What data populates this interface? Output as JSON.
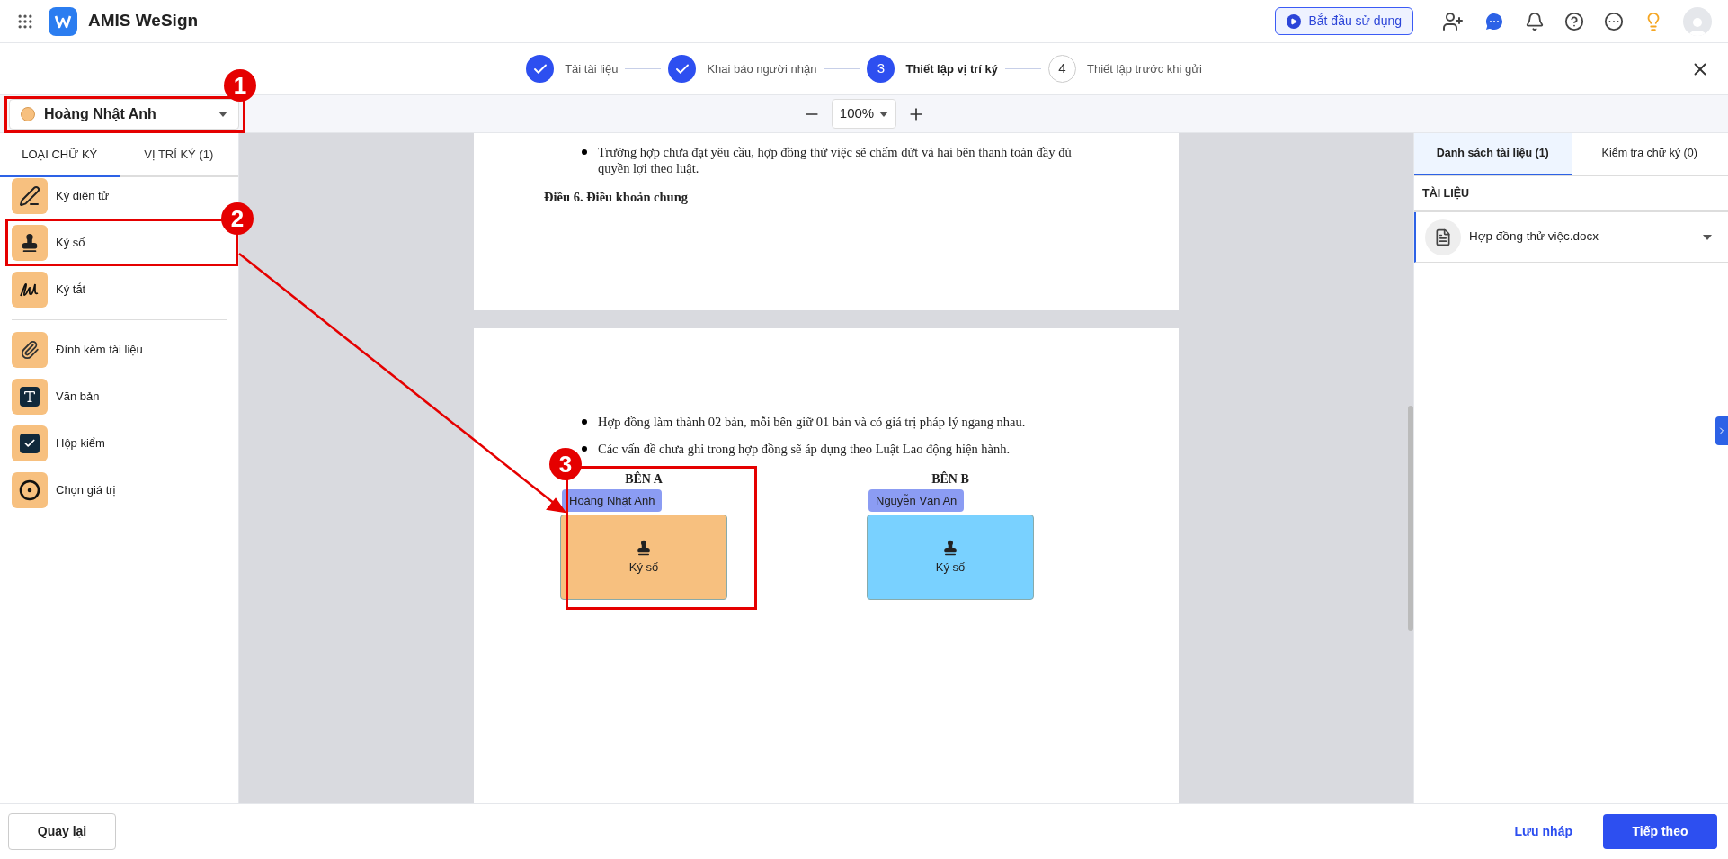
{
  "app": {
    "name": "AMIS WeSign"
  },
  "header": {
    "start_button": "Bắt đầu sử dụng"
  },
  "steps": [
    {
      "kind": "done",
      "label": "Tải tài liệu"
    },
    {
      "kind": "done",
      "label": "Khai báo người nhận"
    },
    {
      "kind": "current",
      "number": "3",
      "label": "Thiết lập vị trí ký"
    },
    {
      "kind": "pending",
      "number": "4",
      "label": "Thiết lập trước khi gửi"
    }
  ],
  "signer": {
    "name": "Hoàng Nhật Anh",
    "color": "#f7c07f"
  },
  "zoom": {
    "value": "100%"
  },
  "left_tabs": [
    {
      "label": "LOẠI CHỮ KÝ",
      "selected": true
    },
    {
      "label": "VỊ TRÍ KÝ (1)",
      "selected": false
    }
  ],
  "signature_types": [
    {
      "kind": "pen",
      "label": "Ký điện tử"
    },
    {
      "kind": "stamp",
      "label": "Ký số"
    },
    {
      "kind": "initials",
      "label": "Ký tắt"
    }
  ],
  "field_types": [
    {
      "kind": "attach",
      "label": "Đính kèm tài liệu"
    },
    {
      "kind": "text",
      "label": "Văn bản"
    },
    {
      "kind": "checkbox",
      "label": "Hộp kiểm"
    },
    {
      "kind": "radio",
      "label": "Chọn giá trị"
    }
  ],
  "document": {
    "page_1": [
      {
        "kind": "bullet",
        "text": "Trường hợp chưa đạt yêu cầu, hợp đồng thử việc sẽ chấm dứt và hai bên thanh toán đầy đủ quyền lợi theo luật."
      },
      {
        "kind": "heading",
        "text": "Điều 6. Điều khoản chung"
      }
    ],
    "page_2": [
      {
        "kind": "bullet",
        "text": "Hợp đồng làm thành 02 bản, mỗi bên giữ 01 bản và có giá trị pháp lý ngang nhau."
      },
      {
        "kind": "bullet",
        "text": "Các vấn đề chưa ghi trong hợp đồng sẽ áp dụng theo Luật Lao động hiện hành."
      }
    ],
    "signature_fields": [
      {
        "party": "BÊN A",
        "signer": "Hoàng Nhật Anh",
        "label": "Ký số",
        "color": "#f7c07f"
      },
      {
        "party": "BÊN B",
        "signer": "Nguyễn Văn An",
        "label": "Ký số",
        "color": "#79d1ff"
      }
    ]
  },
  "right_tabs": [
    {
      "label": "Danh sách tài liệu (1)",
      "selected": true
    },
    {
      "label": "Kiểm tra chữ ký (0)",
      "selected": false
    }
  ],
  "documents_section": {
    "title": "TÀI LIỆU",
    "files": [
      {
        "name": "Hợp đồng thử việc.docx",
        "selected": true
      }
    ]
  },
  "footer": {
    "back": "Quay lại",
    "draft": "Lưu nháp",
    "next": "Tiếp theo"
  },
  "callouts": [
    "1",
    "2",
    "3"
  ]
}
